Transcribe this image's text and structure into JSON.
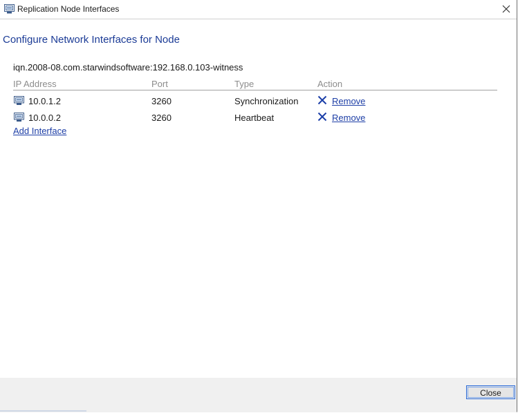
{
  "window": {
    "title": "Replication Node Interfaces",
    "title_icon": "network-interface-icon",
    "close_icon": "close-icon"
  },
  "main": {
    "heading": "Configure Network Interfaces for Node",
    "iqn": "iqn.2008-08.com.starwindsoftware:192.168.0.103-witness",
    "columns": [
      "IP Address",
      "Port",
      "Type",
      "Action"
    ],
    "rows": [
      {
        "ip": "10.0.1.2",
        "port": "3260",
        "type": "Synchronization",
        "action": "Remove",
        "icon": "network-interface-icon",
        "action_icon": "remove-x-icon"
      },
      {
        "ip": "10.0.0.2",
        "port": "3260",
        "type": "Heartbeat",
        "action": "Remove",
        "icon": "network-interface-icon",
        "action_icon": "remove-x-icon"
      }
    ],
    "add_interface": "Add Interface"
  },
  "footer": {
    "close_label": "Close"
  },
  "colors": {
    "heading": "#1b3b96",
    "link": "#1d3ea6",
    "remove_icon": "#1c3fa8",
    "column_header": "#8c8c8c",
    "footer_bg": "#f0f0f0",
    "button_border": "#2a6ad8"
  }
}
